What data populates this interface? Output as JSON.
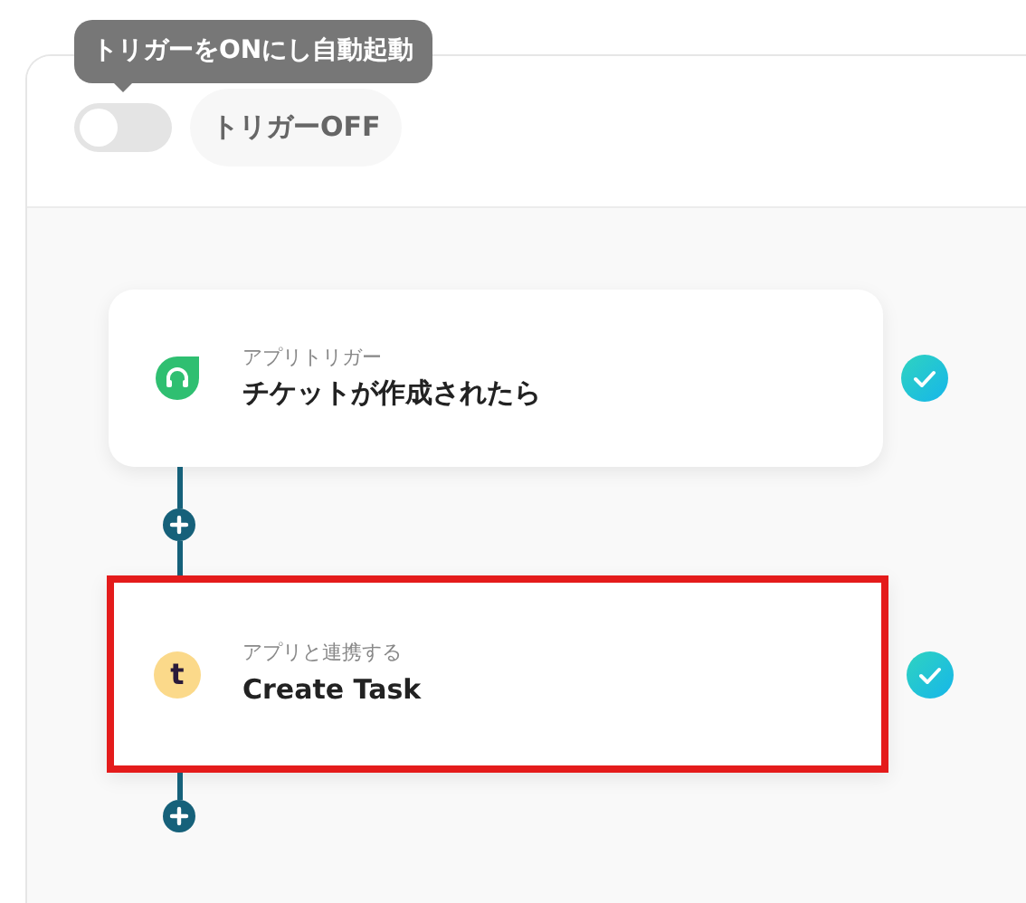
{
  "tooltip": {
    "text": "トリガーをONにし自動起動"
  },
  "trigger": {
    "on": false,
    "label": "トリガーOFF"
  },
  "steps": [
    {
      "kind": "trigger",
      "caption": "アプリトリガー",
      "title": "チケットが作成されたら",
      "done": true,
      "highlighted": false
    },
    {
      "kind": "action",
      "caption": "アプリと連携する",
      "title": "Create Task",
      "icon_letter": "t",
      "done": true,
      "highlighted": true
    }
  ]
}
